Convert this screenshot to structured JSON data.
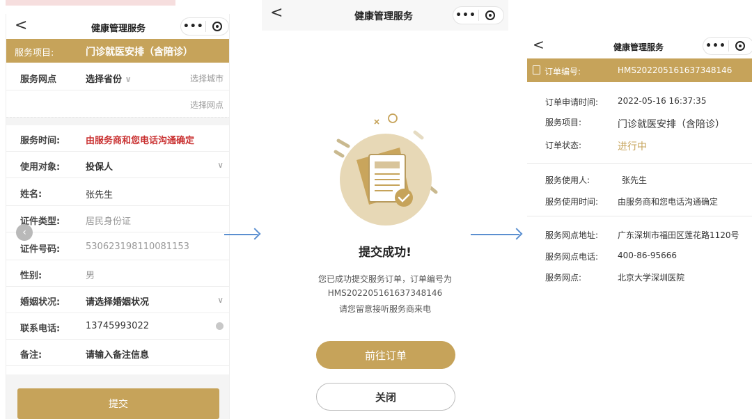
{
  "colors": {
    "accent": "#c6a35a",
    "required_red": "#c93030",
    "arrow_blue": "#5b8fd0"
  },
  "icons": {
    "back": "chevron-left-icon",
    "more": "more-dots-icon",
    "record": "record-icon"
  },
  "form": {
    "nav": {
      "back": "<",
      "title": "健康管理服务",
      "more": "•••"
    },
    "header": {
      "label": "服务项目:",
      "value": "门诊就医安排（含陪诊）"
    },
    "rows": {
      "site": {
        "label": "服务网点",
        "province": "选择省份",
        "city": "选择城市",
        "outlet": "选择网点"
      },
      "time": {
        "label": "服务时间:",
        "value": "由服务商和您电话沟通确定"
      },
      "target": {
        "label": "使用对象:",
        "value": "投保人"
      },
      "name": {
        "label": "姓名:",
        "value": "张先生"
      },
      "id_type": {
        "label": "证件类型:",
        "value": "居民身份证"
      },
      "id_no": {
        "label": "证件号码:",
        "value": "530623198110081153"
      },
      "gender": {
        "label": "性别:",
        "value": "男"
      },
      "marital": {
        "label": "婚姻状况:",
        "value": "请选择婚姻状况"
      },
      "phone": {
        "label": "联系电话:",
        "value": "13745993022"
      },
      "note": {
        "label": "备注:",
        "value": "请输入备注信息"
      }
    },
    "submit": "提交"
  },
  "success": {
    "nav": {
      "back": "<",
      "title": "健康管理服务",
      "more": "•••"
    },
    "title": "提交成功!",
    "msg1": "您已成功提交服务订单，订单编号为",
    "msg2": "HMS202205161637348146",
    "msg3": "请您留意接听服务商来电",
    "goto_order": "前往订单",
    "close": "关闭"
  },
  "detail": {
    "nav": {
      "back": "<",
      "title": "健康管理服务",
      "more": "•••"
    },
    "header": {
      "label": "订单编号:",
      "value": "HMS202205161637348146"
    },
    "fields": {
      "apply_time": {
        "label": "订单申请时间:",
        "value": "2022-05-16 16:37:35"
      },
      "service": {
        "label": "服务项目:",
        "value": "门诊就医安排（含陪诊）"
      },
      "status": {
        "label": "订单状态:",
        "value": "进行中"
      },
      "user": {
        "label": "服务使用人:",
        "value": "张先生"
      },
      "use_time": {
        "label": "服务使用时间:",
        "value": "由服务商和您电话沟通确定"
      },
      "address": {
        "label": "服务网点地址:",
        "value": "广东深圳市福田区莲花路1120号"
      },
      "tel": {
        "label": "服务网点电话:",
        "value": "400-86-95666"
      },
      "outlet": {
        "label": "服务网点:",
        "value": "北京大学深圳医院"
      }
    }
  }
}
